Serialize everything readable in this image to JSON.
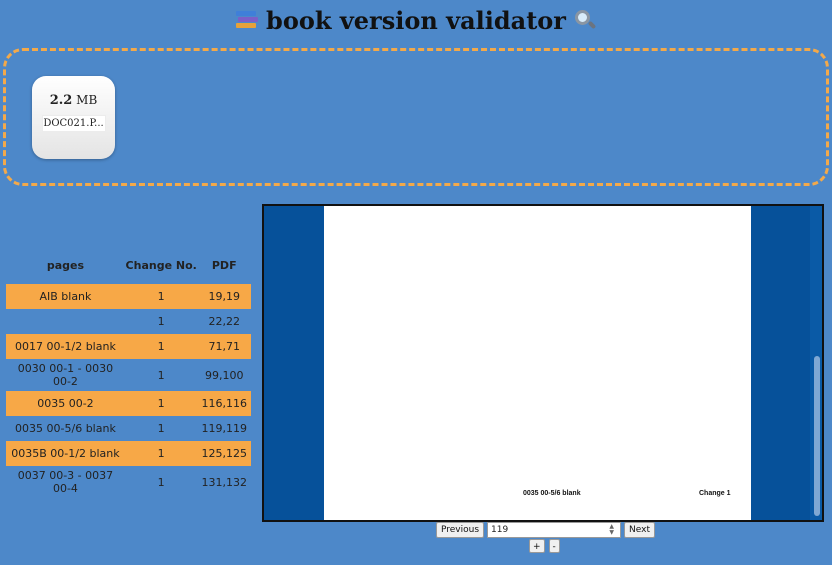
{
  "header": {
    "title": "book version validator",
    "left_icon": "books-icon",
    "right_icon": "magnifier-icon"
  },
  "upload": {
    "file": {
      "size_value": "2.2",
      "size_unit": "MB",
      "name": "DOC021.P..."
    }
  },
  "table": {
    "headers": [
      "pages",
      "Change No.",
      "PDF"
    ],
    "rows": [
      {
        "pages": "AIB blank",
        "change": "1",
        "pdf": "19,19",
        "highlight": true
      },
      {
        "pages": "",
        "change": "1",
        "pdf": "22,22",
        "highlight": false
      },
      {
        "pages": "0017 00-1/2 blank",
        "change": "1",
        "pdf": "71,71",
        "highlight": true
      },
      {
        "pages": "0030 00-1 - 0030 00-2",
        "change": "1",
        "pdf": "99,100",
        "highlight": false
      },
      {
        "pages": "0035 00-2",
        "change": "1",
        "pdf": "116,116",
        "highlight": true
      },
      {
        "pages": "0035 00-5/6 blank",
        "change": "1",
        "pdf": "119,119",
        "highlight": false
      },
      {
        "pages": "0035B 00-1/2 blank",
        "change": "1",
        "pdf": "125,125",
        "highlight": true
      },
      {
        "pages": "0037 00-3 - 0037 00-4",
        "change": "1",
        "pdf": "131,132",
        "highlight": false
      }
    ]
  },
  "viewer": {
    "page_footer_left": "0035 00-5/6 blank",
    "page_footer_right": "Change 1"
  },
  "controls": {
    "previous_label": "Previous",
    "page_number": "119",
    "next_label": "Next",
    "zoom_in_label": "+",
    "zoom_out_label": "-"
  },
  "colors": {
    "background": "#4d88c9",
    "highlight_row": "#f7a847",
    "dropzone_border": "#f3a94a",
    "viewer_bg": "#06519a"
  }
}
